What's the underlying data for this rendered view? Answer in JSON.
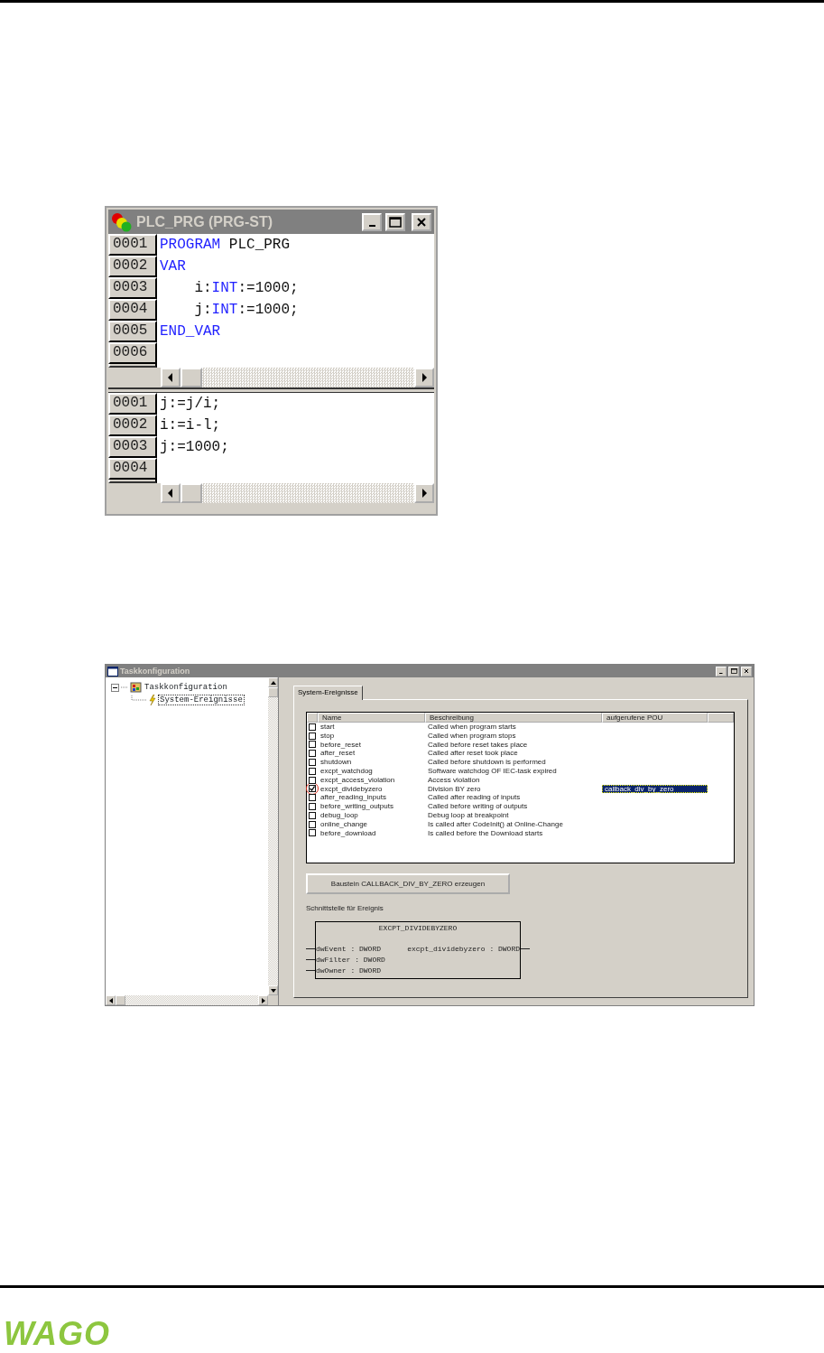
{
  "editor_window": {
    "title": "PLC_PRG (PRG-ST)",
    "declaration": [
      {
        "number": "0001",
        "tokens": [
          {
            "kind": "keyword",
            "text": "PROGRAM"
          },
          {
            "kind": "plain",
            "text": " PLC_PRG"
          }
        ]
      },
      {
        "number": "0002",
        "tokens": [
          {
            "kind": "keyword",
            "text": "VAR"
          }
        ]
      },
      {
        "number": "0003",
        "tokens": [
          {
            "kind": "plain",
            "text": "    i:"
          },
          {
            "kind": "keyword",
            "text": "INT"
          },
          {
            "kind": "plain",
            "text": ":=1000;"
          }
        ]
      },
      {
        "number": "0004",
        "tokens": [
          {
            "kind": "plain",
            "text": "    j:"
          },
          {
            "kind": "keyword",
            "text": "INT"
          },
          {
            "kind": "plain",
            "text": ":=1000;"
          }
        ]
      },
      {
        "number": "0005",
        "tokens": [
          {
            "kind": "keyword",
            "text": "END_VAR"
          }
        ]
      },
      {
        "number": "0006"
      }
    ],
    "body": [
      {
        "number": "0001",
        "tokens": [
          {
            "kind": "plain",
            "text": "j:=j/i;"
          }
        ]
      },
      {
        "number": "0002",
        "tokens": [
          {
            "kind": "plain",
            "text": "i:=i-l;"
          }
        ]
      },
      {
        "number": "0003",
        "tokens": [
          {
            "kind": "plain",
            "text": "j:=1000;"
          }
        ]
      },
      {
        "number": "0004"
      }
    ]
  },
  "task_window": {
    "title": "Taskkonfiguration",
    "tree": [
      {
        "label": "Taskkonfiguration",
        "expanded": true,
        "selected": false,
        "children": [
          {
            "label": "System-Ereignisse",
            "selected": true
          }
        ]
      }
    ],
    "tabs": [
      {
        "label": "System-Ereignisse",
        "selected": true
      }
    ],
    "table": {
      "columns": [
        "Name",
        "Beschreibung",
        "aufgerufene POU"
      ],
      "rows": [
        {
          "checked": false,
          "highlighted": false,
          "name": "start",
          "description": "Called when program starts"
        },
        {
          "checked": false,
          "highlighted": false,
          "name": "stop",
          "description": "Called when program stops"
        },
        {
          "checked": false,
          "highlighted": false,
          "name": "before_reset",
          "description": "Called before reset takes place"
        },
        {
          "checked": false,
          "highlighted": false,
          "name": "after_reset",
          "description": "Called after reset took place"
        },
        {
          "checked": false,
          "highlighted": false,
          "name": "shutdown",
          "description": "Called before shutdown is performed"
        },
        {
          "checked": false,
          "highlighted": false,
          "name": "excpt_watchdog",
          "description": "Software watchdog OF IEC-task expired"
        },
        {
          "checked": false,
          "highlighted": false,
          "name": "excpt_access_violation",
          "description": "Access violation"
        },
        {
          "checked": true,
          "highlighted": true,
          "name": "excpt_dividebyzero",
          "description": "Division BY zero",
          "pou": {
            "text": "callback_div_by_zero",
            "selected": true
          }
        },
        {
          "checked": false,
          "highlighted": false,
          "name": "after_reading_inputs",
          "description": "Called after reading of inputs"
        },
        {
          "checked": false,
          "highlighted": false,
          "name": "before_writing_outputs",
          "description": "Called before writing of outputs"
        },
        {
          "checked": false,
          "highlighted": false,
          "name": "debug_loop",
          "description": "Debug loop at breakpoint"
        },
        {
          "checked": false,
          "highlighted": false,
          "name": "online_change",
          "description": "Is called after CodeInit() at Online-Change"
        },
        {
          "checked": false,
          "highlighted": false,
          "name": "before_download",
          "description": "Is called before the Download starts"
        }
      ]
    },
    "create_button": "Baustein CALLBACK_DIV_BY_ZERO erzeugen",
    "interface_label": "Schnittstelle für Ereignis",
    "function_block": {
      "title": "EXCPT_DIVIDEBYZERO",
      "inputs": [
        "dwEvent : DWORD",
        "dwFilter : DWORD",
        "dwOwner : DWORD"
      ],
      "output": "excpt_dividebyzero : DWORD"
    }
  },
  "footer": {
    "logo": "WAGO"
  }
}
